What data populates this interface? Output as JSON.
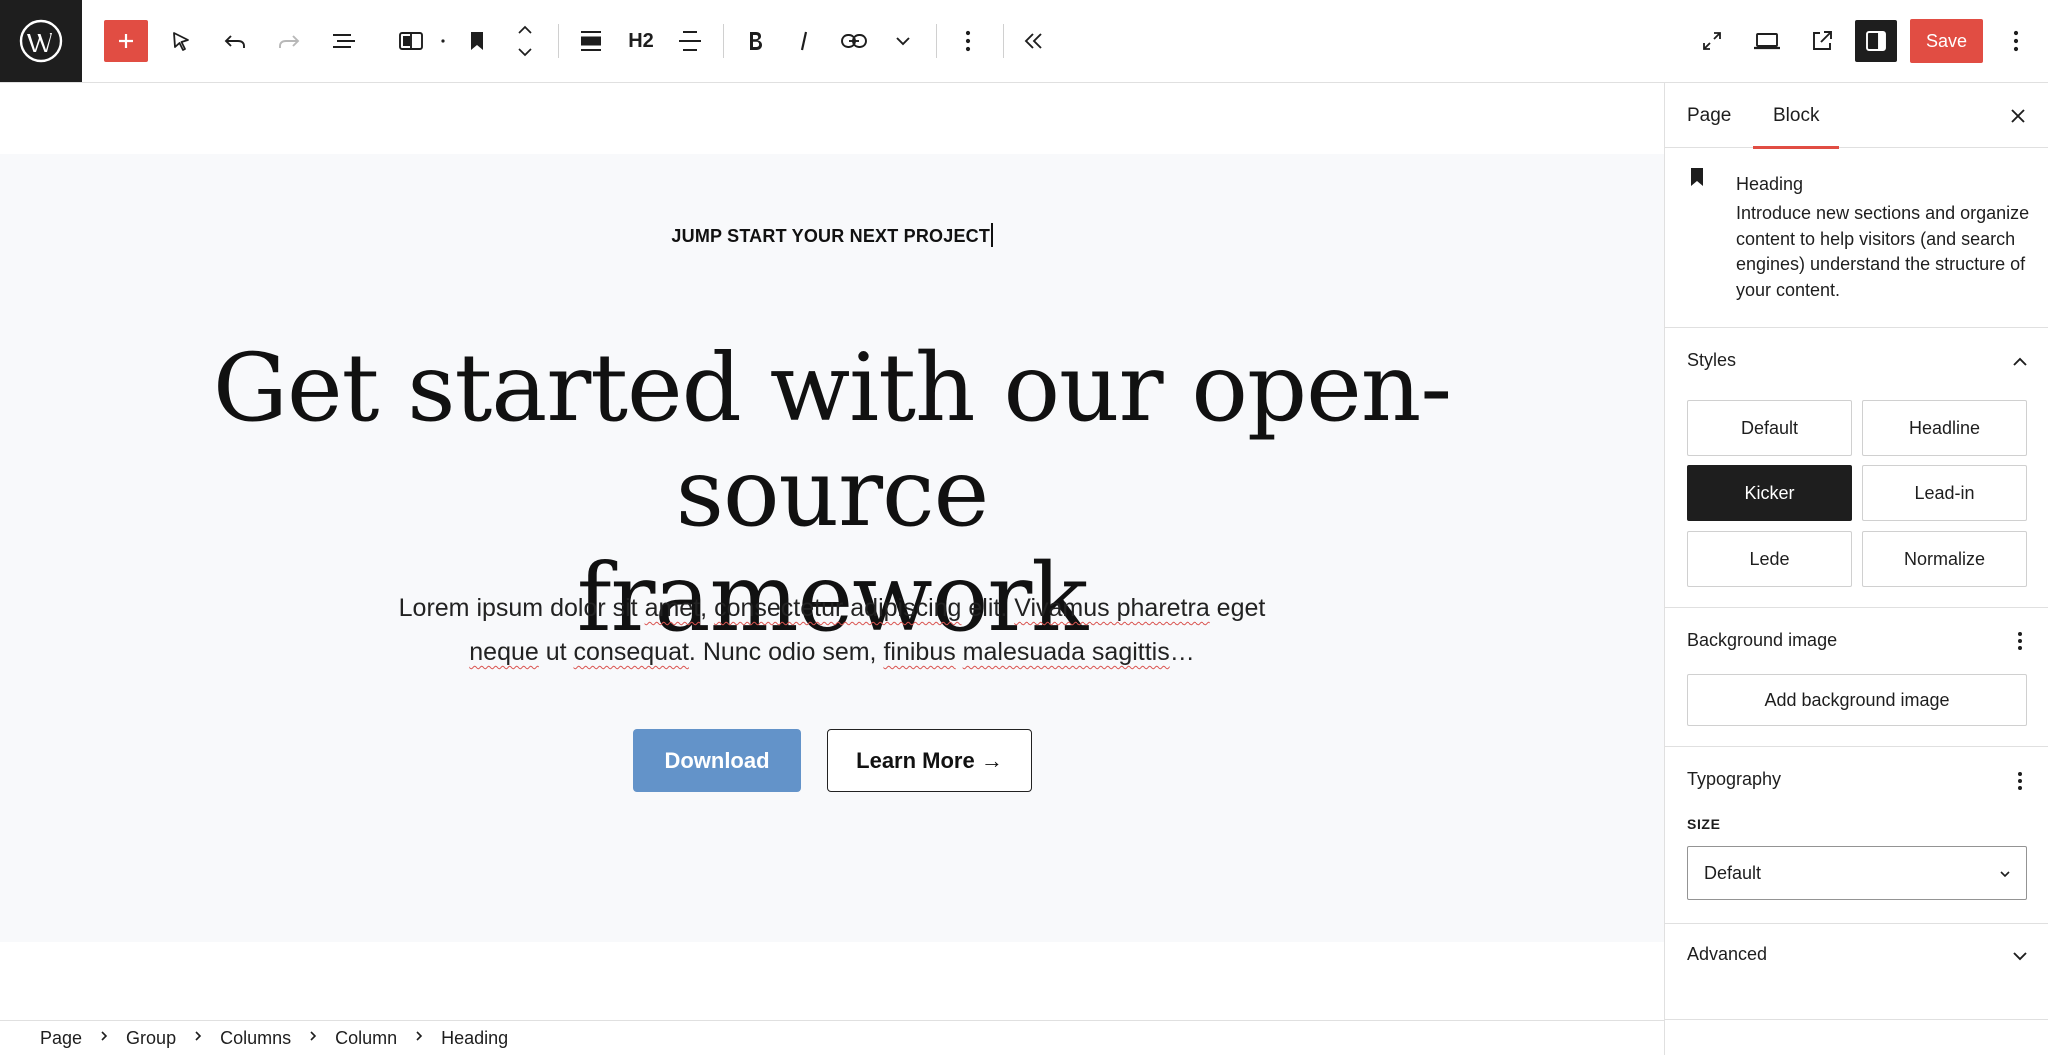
{
  "toolbar": {
    "heading_level": "H2",
    "save_label": "Save"
  },
  "hero": {
    "kicker": "JUMP START YOUR NEXT PROJECT",
    "headline_line1": "Get started with our open-source",
    "headline_line2": "framework",
    "lede": [
      {
        "t": "Lorem ipsum dolor sit ",
        "sq": false
      },
      {
        "t": "amet",
        "sq": true
      },
      {
        "t": ", ",
        "sq": false
      },
      {
        "t": "consectetur adipiscing",
        "sq": true
      },
      {
        "t": " elit. ",
        "sq": false
      },
      {
        "t": "Vivamus pharetra",
        "sq": true
      },
      {
        "t": " eget ",
        "sq": false
      },
      {
        "t": "neque",
        "sq": true
      },
      {
        "t": " ut ",
        "sq": false
      },
      {
        "t": "consequat",
        "sq": true
      },
      {
        "t": ". Nunc odio sem, ",
        "sq": false
      },
      {
        "t": "finibus",
        "sq": true
      },
      {
        "t": " ",
        "sq": false
      },
      {
        "t": "malesuada sagittis",
        "sq": true
      },
      {
        "t": "…",
        "sq": false
      }
    ],
    "download_label": "Download",
    "learn_more_label": "Learn More →"
  },
  "breadcrumb": [
    "Page",
    "Group",
    "Columns",
    "Column",
    "Heading"
  ],
  "sidebar": {
    "tabs": [
      "Page",
      "Block"
    ],
    "active_tab": "Block",
    "block": {
      "title": "Heading",
      "description": "Introduce new sections and organize content to help visitors (and search engines) understand the structure of your content."
    },
    "styles": {
      "title": "Styles",
      "options": [
        "Default",
        "Headline",
        "Kicker",
        "Lead-in",
        "Lede",
        "Normalize"
      ],
      "selected": "Kicker"
    },
    "background": {
      "title": "Background image",
      "button": "Add background image"
    },
    "typography": {
      "title": "Typography",
      "size_label": "SIZE",
      "size_value": "Default"
    },
    "advanced": {
      "title": "Advanced"
    }
  },
  "colors": {
    "accent": "#e14d43",
    "download_bg": "#6393c9",
    "dark": "#1e1e1e"
  }
}
